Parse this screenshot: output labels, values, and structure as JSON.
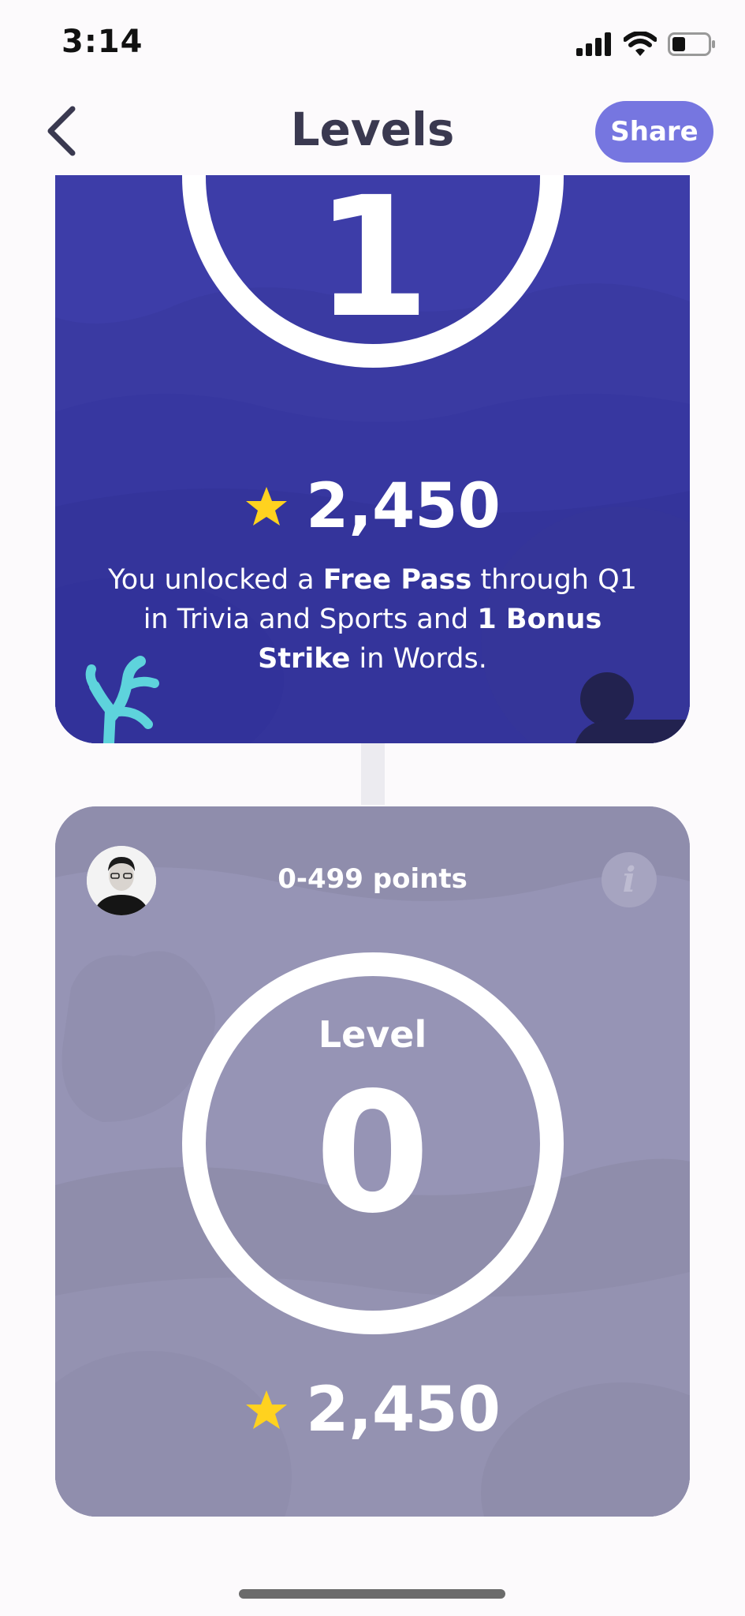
{
  "status_bar": {
    "time": "3:14"
  },
  "nav": {
    "title": "Levels",
    "share_label": "Share"
  },
  "current_level_card": {
    "level_number": "1",
    "score": "2,450",
    "reward_parts": {
      "p1": "You unlocked a ",
      "b1": "Free Pass",
      "p2": " through Q1 in Trivia and Sports and ",
      "b2": "1 Bonus Strike",
      "p3": " in Words."
    }
  },
  "previous_level_card": {
    "points_range": "0-499 points",
    "level_label": "Level",
    "level_number": "0",
    "score": "2,450"
  },
  "colors": {
    "accent": "#7676e0",
    "unlocked_card": "#3a3aa2",
    "locked_card": "#9694b5",
    "star": "#ffd21f",
    "coral": "#5ed3dc"
  }
}
